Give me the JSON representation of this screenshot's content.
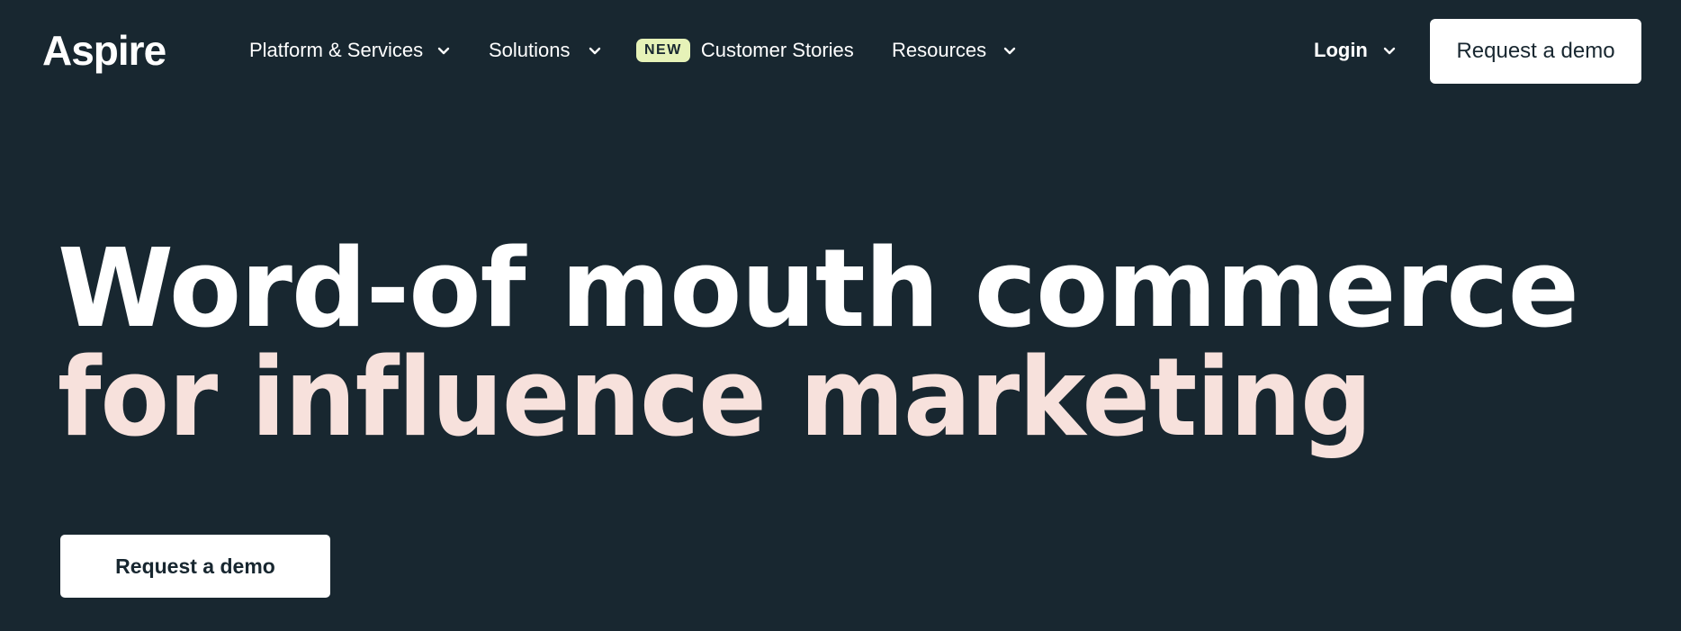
{
  "brand": {
    "logo_text": "Aspire"
  },
  "nav": {
    "items": [
      {
        "label": "Platform & Services",
        "has_dropdown": true
      },
      {
        "label": "Solutions",
        "has_dropdown": true
      },
      {
        "label": "Customer Stories",
        "badge": "NEW",
        "has_dropdown": false
      },
      {
        "label": "Resources",
        "has_dropdown": true
      }
    ],
    "login_label": "Login",
    "cta_label": "Request a demo"
  },
  "hero": {
    "headline_line1": "Word-of mouth commerce",
    "headline_line2": "for influence marketing",
    "cta_label": "Request a demo"
  },
  "colors": {
    "background": "#182730",
    "headline_primary": "#ffffff",
    "headline_accent": "#f7e1dc",
    "badge_bg": "#e6f2b8"
  }
}
